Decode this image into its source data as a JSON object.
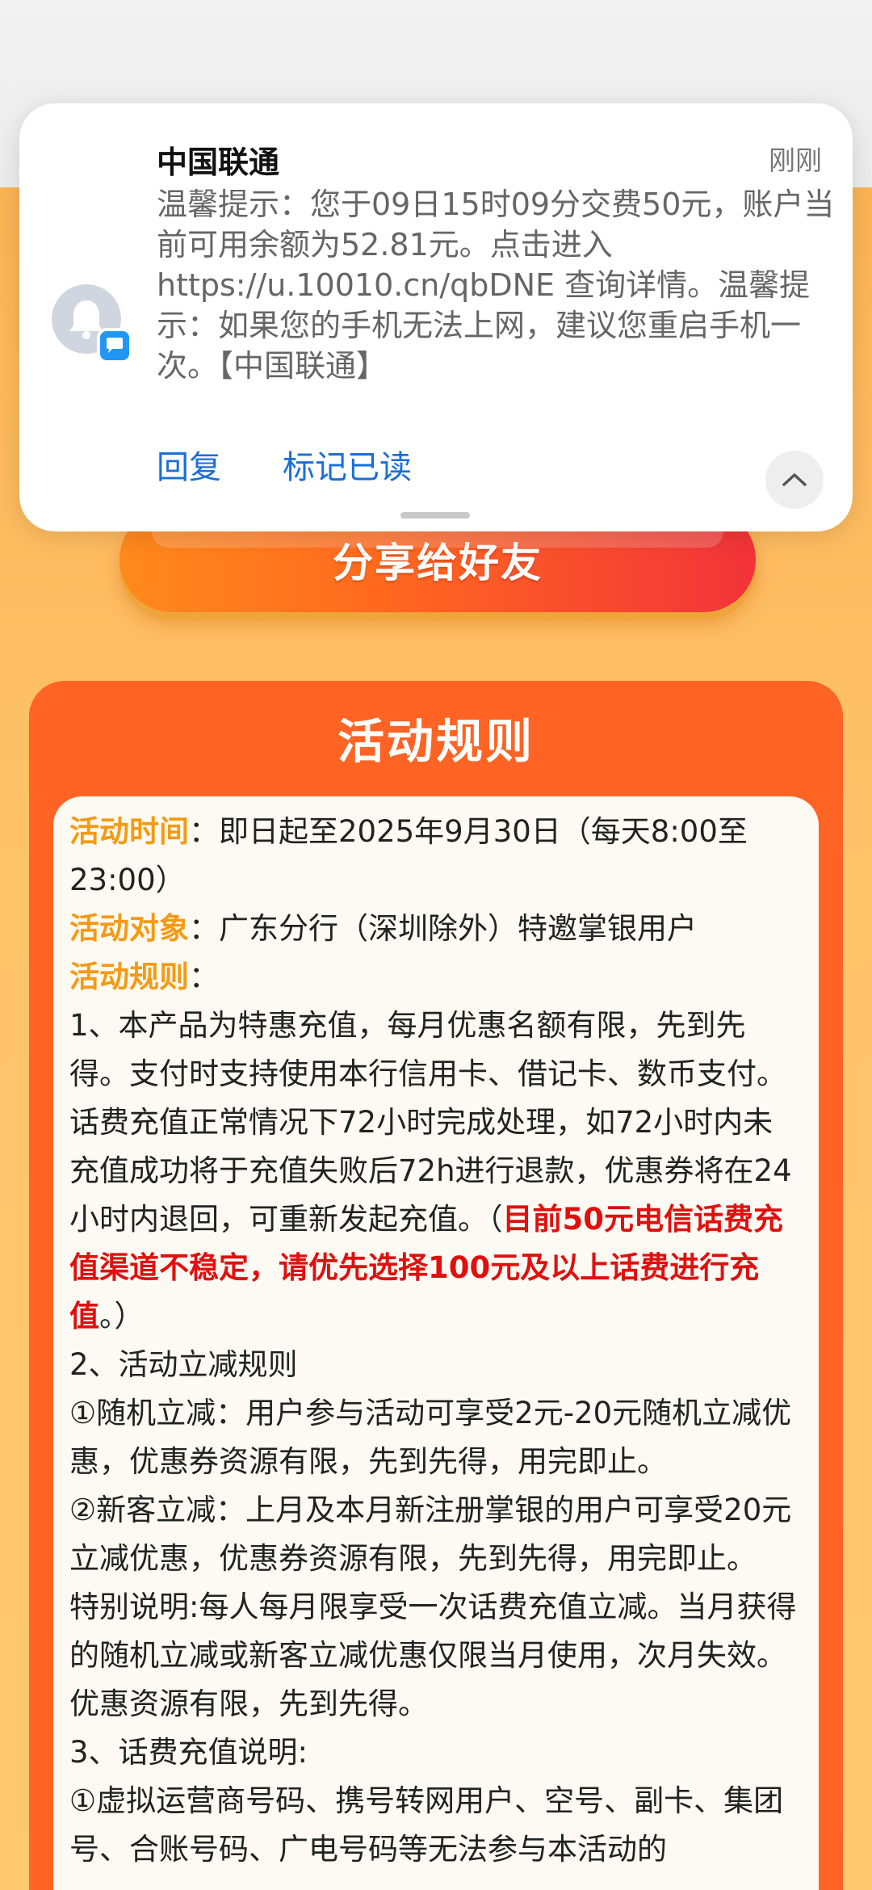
{
  "notification": {
    "sender": "中国联通",
    "time": "刚刚",
    "body": "温馨提示：您于09日15时09分交费50元，账户当前可用余额为52.81元。点击进入https://u.10010.cn/qbDNE 查询详情。温馨提示：如果您的手机无法上网，建议您重启手机一次。【中国联通】",
    "actions": {
      "reply": "回复",
      "mark_read": "标记已读"
    },
    "icons": {
      "avatar": "bell-icon",
      "badge": "message-icon",
      "collapse": "chevron-up-icon"
    }
  },
  "share_button": {
    "label": "分享给好友"
  },
  "rules": {
    "title": "活动规则",
    "time_label": "活动时间",
    "time_text": "：即日起至2025年9月30日（每天8:00至23:00）",
    "target_label": "活动对象",
    "target_text": "：广东分行（深圳除外）特邀掌银用户",
    "rules_label": "活动规则",
    "rules_colon": "：",
    "item1_text": "1、本产品为特惠充值，每月优惠名额有限，先到先得。支付时支持使用本行信用卡、借记卡、数币支付。话费充值正常情况下72小时完成处理，如72小时内未充值成功将于充值失败后72h进行退款，优惠券将在24小时内退回，可重新发起充值。（",
    "item1_red": "目前50元电信话费充值渠道不稳定，请优先选择100元及以上话费进行充值",
    "item1_end": "。）",
    "item2_title": "2、活动立减规则",
    "item2_a": "①随机立减：用户参与活动可享受2元-20元随机立减优惠，优惠券资源有限，先到先得，用完即止。",
    "item2_b": "②新客立减：上月及本月新注册掌银的用户可享受20元立减优惠，优惠券资源有限，先到先得，用完即止。",
    "special": "特别说明:每人每月限享受一次话费充值立减。当月获得的随机立减或新客立减优惠仅限当月使用，次月失效。优惠资源有限，先到先得。",
    "item3_title": "3、话费充值说明:",
    "item3_a": "①虚拟运营商号码、携号转网用户、空号、副卡、集团号、合账号码、广电号码等无法参与本活动的"
  },
  "colors": {
    "accent_orange": "#ff6424",
    "label_orange": "#f59a13",
    "warning_red": "#e0100e",
    "link_blue": "#1a6fd8"
  }
}
